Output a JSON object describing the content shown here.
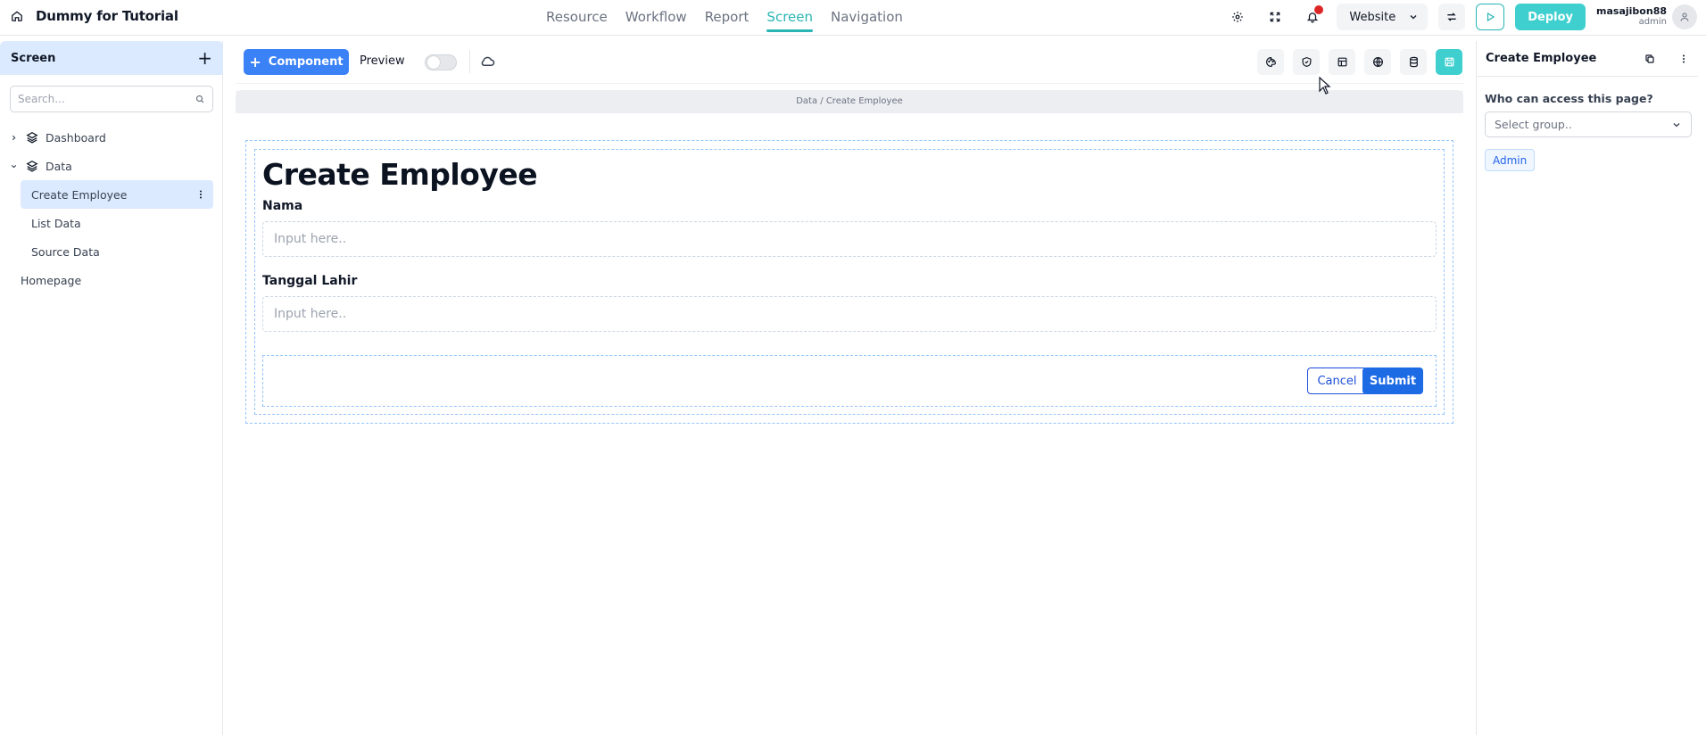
{
  "app": {
    "title": "Dummy for Tutorial"
  },
  "nav": {
    "items": [
      {
        "label": "Resource",
        "active": false
      },
      {
        "label": "Workflow",
        "active": false
      },
      {
        "label": "Report",
        "active": false
      },
      {
        "label": "Screen",
        "active": true
      },
      {
        "label": "Navigation",
        "active": false
      }
    ]
  },
  "topbar": {
    "platform_select": "Website",
    "deploy_label": "Deploy",
    "user": {
      "name": "masajibon88",
      "role": "admin"
    },
    "has_notification": true
  },
  "sidebar": {
    "title": "Screen",
    "search_placeholder": "Search...",
    "tree": [
      {
        "label": "Dashboard",
        "type": "folder",
        "expanded": false
      },
      {
        "label": "Data",
        "type": "folder",
        "expanded": true
      },
      {
        "label": "Create Employee",
        "type": "page",
        "selected": true
      },
      {
        "label": "List Data",
        "type": "page"
      },
      {
        "label": "Source Data",
        "type": "page"
      },
      {
        "label": "Homepage",
        "type": "page"
      }
    ]
  },
  "toolbar": {
    "component_label": "Component",
    "preview_label": "Preview",
    "preview_enabled": false
  },
  "canvas": {
    "breadcrumb": "Data / Create Employee",
    "form": {
      "heading": "Create Employee",
      "fields": [
        {
          "label": "Nama",
          "placeholder": "Input here.."
        },
        {
          "label": "Tanggal Lahir",
          "placeholder": "Input here.."
        }
      ],
      "cancel_label": "Cancel",
      "submit_label": "Submit"
    }
  },
  "right_panel": {
    "title": "Create Employee",
    "access_question": "Who can access this page?",
    "group_placeholder": "Select group..",
    "selected_groups": [
      "Admin"
    ]
  },
  "colors": {
    "accent": "#2ab5b5",
    "deploy": "#3fcfcf",
    "primary": "#3b82f6",
    "submit": "#1d6ae5",
    "notification": "#dc2626"
  }
}
